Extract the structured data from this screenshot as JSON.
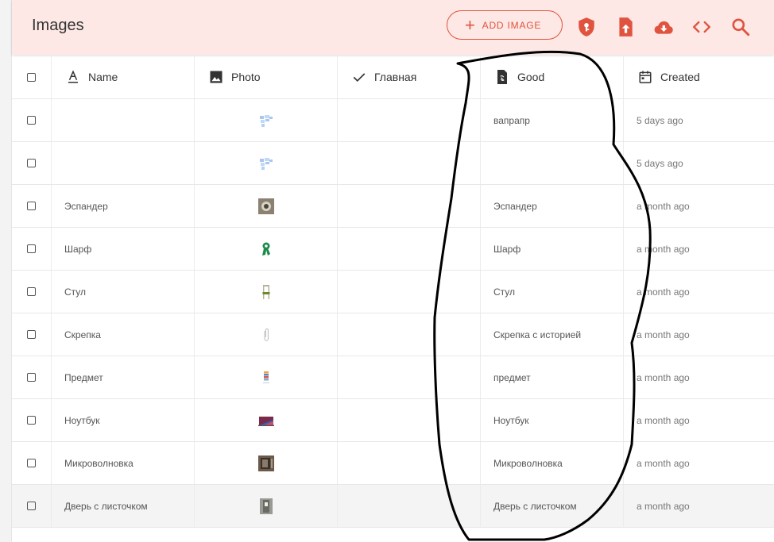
{
  "header": {
    "title": "Images",
    "add_button_label": "ADD IMAGE",
    "icons": [
      "shield-key-icon",
      "file-upload-icon",
      "cloud-download-icon",
      "code-icon",
      "search-icon"
    ],
    "accent_color": "#e0533e",
    "background_color": "#fde8e5"
  },
  "columns": [
    {
      "label": "Name",
      "icon": "text-format-icon"
    },
    {
      "label": "Photo",
      "icon": "image-icon"
    },
    {
      "label": "Главная",
      "icon": "check-icon"
    },
    {
      "label": "Good",
      "icon": "link-file-icon"
    },
    {
      "label": "Created",
      "icon": "calendar-icon"
    }
  ],
  "rows": [
    {
      "name": "",
      "photo": "image-thumbnail",
      "main": "",
      "good": "вапрапр",
      "created": "5 days ago"
    },
    {
      "name": "",
      "photo": "image-thumbnail",
      "main": "",
      "good": "",
      "created": "5 days ago"
    },
    {
      "name": "Эспандер",
      "photo": "expander-photo",
      "main": "",
      "good": "Эспандер",
      "created": "a month ago"
    },
    {
      "name": "Шарф",
      "photo": "scarf-photo",
      "main": "",
      "good": "Шарф",
      "created": "a month ago"
    },
    {
      "name": "Стул",
      "photo": "chair-photo",
      "main": "",
      "good": "Стул",
      "created": "a month ago"
    },
    {
      "name": "Скрепка",
      "photo": "paperclip-photo",
      "main": "",
      "good": "Скрепка с историей",
      "created": "a month ago"
    },
    {
      "name": "Предмет",
      "photo": "item-photo",
      "main": "",
      "good": "предмет",
      "created": "a month ago"
    },
    {
      "name": "Ноутбук",
      "photo": "laptop-photo",
      "main": "",
      "good": "Ноутбук",
      "created": "a month ago"
    },
    {
      "name": "Микроволновка",
      "photo": "microwave-photo",
      "main": "",
      "good": "Микроволновка",
      "created": "a month ago"
    },
    {
      "name": "Дверь с листочком",
      "photo": "door-photo",
      "main": "",
      "good": "Дверь с листочком",
      "created": "a month ago"
    }
  ]
}
